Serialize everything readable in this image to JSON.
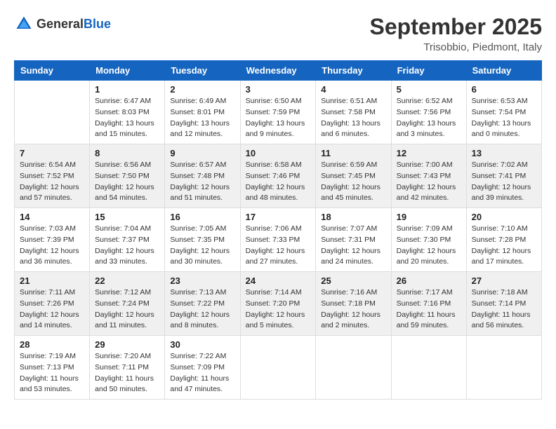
{
  "logo": {
    "text_general": "General",
    "text_blue": "Blue"
  },
  "title": "September 2025",
  "subtitle": "Trisobbio, Piedmont, Italy",
  "headers": [
    "Sunday",
    "Monday",
    "Tuesday",
    "Wednesday",
    "Thursday",
    "Friday",
    "Saturday"
  ],
  "weeks": [
    {
      "days": [
        {
          "num": "",
          "sunrise": "",
          "sunset": "",
          "daylight": ""
        },
        {
          "num": "1",
          "sunrise": "Sunrise: 6:47 AM",
          "sunset": "Sunset: 8:03 PM",
          "daylight": "Daylight: 13 hours and 15 minutes."
        },
        {
          "num": "2",
          "sunrise": "Sunrise: 6:49 AM",
          "sunset": "Sunset: 8:01 PM",
          "daylight": "Daylight: 13 hours and 12 minutes."
        },
        {
          "num": "3",
          "sunrise": "Sunrise: 6:50 AM",
          "sunset": "Sunset: 7:59 PM",
          "daylight": "Daylight: 13 hours and 9 minutes."
        },
        {
          "num": "4",
          "sunrise": "Sunrise: 6:51 AM",
          "sunset": "Sunset: 7:58 PM",
          "daylight": "Daylight: 13 hours and 6 minutes."
        },
        {
          "num": "5",
          "sunrise": "Sunrise: 6:52 AM",
          "sunset": "Sunset: 7:56 PM",
          "daylight": "Daylight: 13 hours and 3 minutes."
        },
        {
          "num": "6",
          "sunrise": "Sunrise: 6:53 AM",
          "sunset": "Sunset: 7:54 PM",
          "daylight": "Daylight: 13 hours and 0 minutes."
        }
      ]
    },
    {
      "days": [
        {
          "num": "7",
          "sunrise": "Sunrise: 6:54 AM",
          "sunset": "Sunset: 7:52 PM",
          "daylight": "Daylight: 12 hours and 57 minutes."
        },
        {
          "num": "8",
          "sunrise": "Sunrise: 6:56 AM",
          "sunset": "Sunset: 7:50 PM",
          "daylight": "Daylight: 12 hours and 54 minutes."
        },
        {
          "num": "9",
          "sunrise": "Sunrise: 6:57 AM",
          "sunset": "Sunset: 7:48 PM",
          "daylight": "Daylight: 12 hours and 51 minutes."
        },
        {
          "num": "10",
          "sunrise": "Sunrise: 6:58 AM",
          "sunset": "Sunset: 7:46 PM",
          "daylight": "Daylight: 12 hours and 48 minutes."
        },
        {
          "num": "11",
          "sunrise": "Sunrise: 6:59 AM",
          "sunset": "Sunset: 7:45 PM",
          "daylight": "Daylight: 12 hours and 45 minutes."
        },
        {
          "num": "12",
          "sunrise": "Sunrise: 7:00 AM",
          "sunset": "Sunset: 7:43 PM",
          "daylight": "Daylight: 12 hours and 42 minutes."
        },
        {
          "num": "13",
          "sunrise": "Sunrise: 7:02 AM",
          "sunset": "Sunset: 7:41 PM",
          "daylight": "Daylight: 12 hours and 39 minutes."
        }
      ]
    },
    {
      "days": [
        {
          "num": "14",
          "sunrise": "Sunrise: 7:03 AM",
          "sunset": "Sunset: 7:39 PM",
          "daylight": "Daylight: 12 hours and 36 minutes."
        },
        {
          "num": "15",
          "sunrise": "Sunrise: 7:04 AM",
          "sunset": "Sunset: 7:37 PM",
          "daylight": "Daylight: 12 hours and 33 minutes."
        },
        {
          "num": "16",
          "sunrise": "Sunrise: 7:05 AM",
          "sunset": "Sunset: 7:35 PM",
          "daylight": "Daylight: 12 hours and 30 minutes."
        },
        {
          "num": "17",
          "sunrise": "Sunrise: 7:06 AM",
          "sunset": "Sunset: 7:33 PM",
          "daylight": "Daylight: 12 hours and 27 minutes."
        },
        {
          "num": "18",
          "sunrise": "Sunrise: 7:07 AM",
          "sunset": "Sunset: 7:31 PM",
          "daylight": "Daylight: 12 hours and 24 minutes."
        },
        {
          "num": "19",
          "sunrise": "Sunrise: 7:09 AM",
          "sunset": "Sunset: 7:30 PM",
          "daylight": "Daylight: 12 hours and 20 minutes."
        },
        {
          "num": "20",
          "sunrise": "Sunrise: 7:10 AM",
          "sunset": "Sunset: 7:28 PM",
          "daylight": "Daylight: 12 hours and 17 minutes."
        }
      ]
    },
    {
      "days": [
        {
          "num": "21",
          "sunrise": "Sunrise: 7:11 AM",
          "sunset": "Sunset: 7:26 PM",
          "daylight": "Daylight: 12 hours and 14 minutes."
        },
        {
          "num": "22",
          "sunrise": "Sunrise: 7:12 AM",
          "sunset": "Sunset: 7:24 PM",
          "daylight": "Daylight: 12 hours and 11 minutes."
        },
        {
          "num": "23",
          "sunrise": "Sunrise: 7:13 AM",
          "sunset": "Sunset: 7:22 PM",
          "daylight": "Daylight: 12 hours and 8 minutes."
        },
        {
          "num": "24",
          "sunrise": "Sunrise: 7:14 AM",
          "sunset": "Sunset: 7:20 PM",
          "daylight": "Daylight: 12 hours and 5 minutes."
        },
        {
          "num": "25",
          "sunrise": "Sunrise: 7:16 AM",
          "sunset": "Sunset: 7:18 PM",
          "daylight": "Daylight: 12 hours and 2 minutes."
        },
        {
          "num": "26",
          "sunrise": "Sunrise: 7:17 AM",
          "sunset": "Sunset: 7:16 PM",
          "daylight": "Daylight: 11 hours and 59 minutes."
        },
        {
          "num": "27",
          "sunrise": "Sunrise: 7:18 AM",
          "sunset": "Sunset: 7:14 PM",
          "daylight": "Daylight: 11 hours and 56 minutes."
        }
      ]
    },
    {
      "days": [
        {
          "num": "28",
          "sunrise": "Sunrise: 7:19 AM",
          "sunset": "Sunset: 7:13 PM",
          "daylight": "Daylight: 11 hours and 53 minutes."
        },
        {
          "num": "29",
          "sunrise": "Sunrise: 7:20 AM",
          "sunset": "Sunset: 7:11 PM",
          "daylight": "Daylight: 11 hours and 50 minutes."
        },
        {
          "num": "30",
          "sunrise": "Sunrise: 7:22 AM",
          "sunset": "Sunset: 7:09 PM",
          "daylight": "Daylight: 11 hours and 47 minutes."
        },
        {
          "num": "",
          "sunrise": "",
          "sunset": "",
          "daylight": ""
        },
        {
          "num": "",
          "sunrise": "",
          "sunset": "",
          "daylight": ""
        },
        {
          "num": "",
          "sunrise": "",
          "sunset": "",
          "daylight": ""
        },
        {
          "num": "",
          "sunrise": "",
          "sunset": "",
          "daylight": ""
        }
      ]
    }
  ]
}
